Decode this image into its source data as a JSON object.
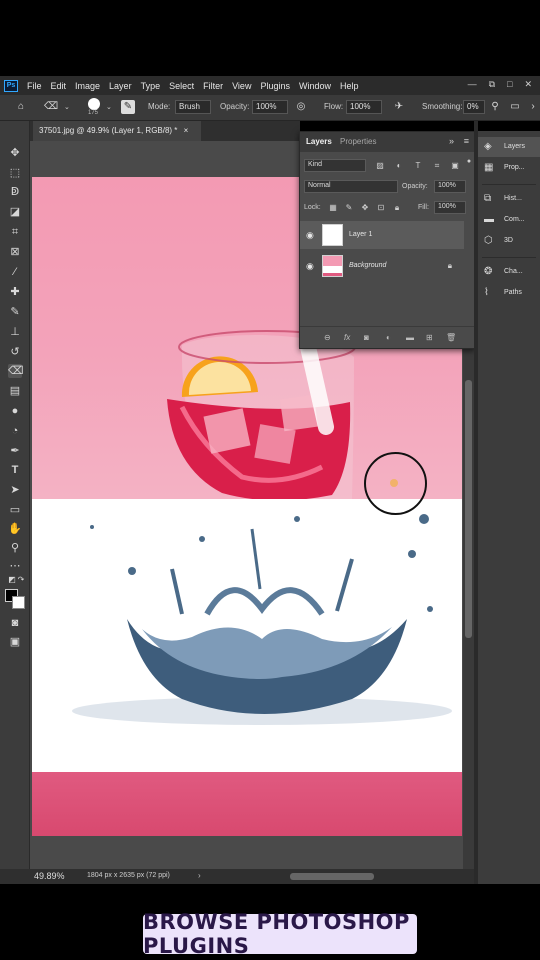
{
  "app": {
    "logo": "Ps"
  },
  "menu": [
    "File",
    "Edit",
    "Image",
    "Layer",
    "Type",
    "Select",
    "Filter",
    "View",
    "Plugins",
    "Window",
    "Help"
  ],
  "window_controls": [
    "—",
    "⧉",
    "□",
    "✕"
  ],
  "options_bar": {
    "brush_size": "175",
    "mode_label": "Mode:",
    "mode_value": "Brush",
    "opacity_label": "Opacity:",
    "opacity_value": "100%",
    "flow_label": "Flow:",
    "flow_value": "100%",
    "smoothing_label": "Smoothing:",
    "smoothing_value": "0%"
  },
  "document_tab": {
    "title": "37501.jpg @ 49.9% (Layer 1, RGB/8) *",
    "close": "×"
  },
  "status_bar": {
    "zoom": "49.89%",
    "doc_size": "1804 px x 2635 px (72 ppi)"
  },
  "layers_panel": {
    "tabs": [
      "Layers",
      "Properties"
    ],
    "filter_kind": "Kind",
    "blend_mode": "Normal",
    "opacity_label": "Opacity:",
    "opacity_value": "100%",
    "lock_label": "Lock:",
    "fill_label": "Fill:",
    "fill_value": "100%",
    "layers": [
      {
        "name": "Layer 1",
        "selected": true,
        "locked": false
      },
      {
        "name": "Background",
        "selected": false,
        "locked": true
      }
    ]
  },
  "right_dock": {
    "groups": [
      [
        "Layers",
        "Prop..."
      ],
      [
        "Hist...",
        "Com...",
        "3D"
      ],
      [
        "Cha...",
        "Paths"
      ]
    ]
  },
  "caption": "BROWSE PHOTOSHOP PLUGINS"
}
